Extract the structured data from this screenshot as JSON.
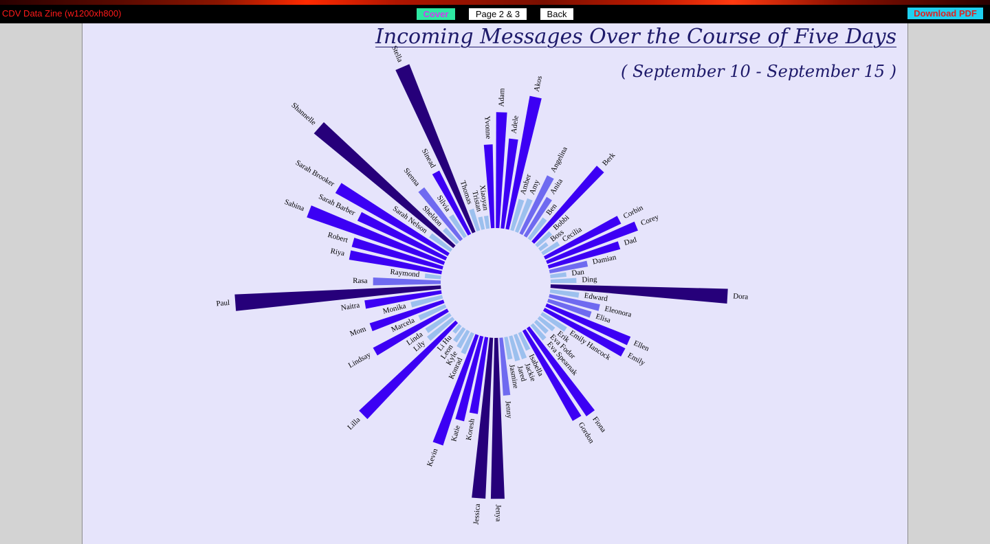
{
  "header": {
    "site_title": "CDV Data Zine (w1200xh800)",
    "cover_label": "Cover",
    "page_label": "Page 2 & 3",
    "back_label": "Back",
    "download_label": "Download PDF"
  },
  "colors": {
    "background": "#e6e4fb",
    "bar_light": "#9cc0ee",
    "bar_mid": "#6f6af0",
    "bar_strong": "#3c00f4",
    "bar_dark": "#26007a"
  },
  "chart_data": {
    "type": "bar",
    "layout": "radial",
    "title": "Incoming Messages Over the Course of Five Days",
    "subtitle": "( September 10 - September 15 )",
    "categories": [
      "Adam",
      "Adele",
      "Akos",
      "Amber",
      "Amy",
      "Angelina",
      "Anita",
      "Ben",
      "Berk",
      "Bobbi",
      "Boss",
      "Cecilia",
      "Corbin",
      "Corey",
      "Dad",
      "Damian",
      "Dan",
      "Ding",
      "Dora",
      "Edward",
      "Eleonora",
      "Elisa",
      "Ellen",
      "Emily",
      "Emily Hancock",
      "Erik",
      "Eva Fodor",
      "Eva Spearnak",
      "Fiona",
      "Gordon",
      "Isabella",
      "Jackie",
      "Jared",
      "Jasmine",
      "Jenny",
      "Jenya",
      "Jessica",
      "Koresh",
      "Katie",
      "Kevin",
      "Konrad",
      "Kyle",
      "Leon",
      "Li Hu",
      "Lilla",
      "Lily",
      "Linda",
      "Lindsay",
      "Marcela",
      "Mom",
      "Monika",
      "Naitra",
      "Paul",
      "Rasa",
      "Raymond",
      "Riya",
      "Robert",
      "Sabina",
      "Sarah Barber",
      "Sarah Brooker",
      "Sarah Nelson",
      "Shannelle",
      "Sheldon",
      "Sienna",
      "Silvia",
      "Sinead",
      "Stella",
      "Thomas",
      "Tristan",
      "Xiaoyan",
      "Yvonne"
    ],
    "values": [
      180,
      140,
      210,
      50,
      55,
      100,
      70,
      40,
      155,
      30,
      15,
      30,
      130,
      150,
      115,
      60,
      25,
      40,
      275,
      45,
      80,
      70,
      140,
      140,
      45,
      30,
      25,
      30,
      165,
      160,
      30,
      40,
      40,
      35,
      90,
      250,
      250,
      120,
      135,
      180,
      35,
      30,
      25,
      15,
      205,
      50,
      45,
      130,
      45,
      120,
      50,
      120,
      320,
      105,
      25,
      145,
      145,
      225,
      150,
      200,
      40,
      280,
      30,
      100,
      40,
      110,
      280,
      35,
      20,
      20,
      130
    ],
    "value_unit": "relative bar length",
    "ylim": [
      0,
      320
    ],
    "grid": false,
    "legend": "none"
  }
}
